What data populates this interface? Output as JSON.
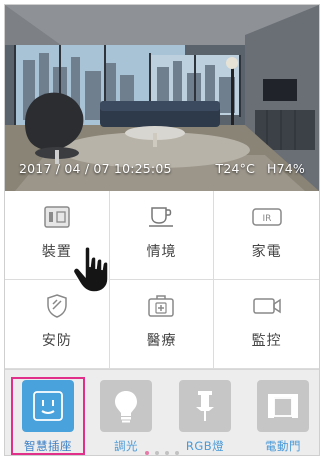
{
  "hero": {
    "datetime": "2017 / 04 / 07 10:25:05",
    "temperature": "T24°C",
    "humidity": "H74%"
  },
  "categories": [
    {
      "label": "裝置",
      "icon": "device-icon"
    },
    {
      "label": "情境",
      "icon": "coffee-cup-icon"
    },
    {
      "label": "家電",
      "icon": "ir-remote-icon"
    },
    {
      "label": "安防",
      "icon": "shield-icon"
    },
    {
      "label": "醫療",
      "icon": "medical-kit-icon"
    },
    {
      "label": "監控",
      "icon": "camera-icon"
    }
  ],
  "scenes": [
    {
      "label": "智慧插座",
      "icon": "socket-icon",
      "active": true
    },
    {
      "label": "調光",
      "icon": "bulb-icon",
      "active": false
    },
    {
      "label": "RGB燈",
      "icon": "pin-lamp-icon",
      "active": false
    },
    {
      "label": "電動門",
      "icon": "motor-door-icon",
      "active": false
    }
  ],
  "pagination": {
    "count": 4,
    "current": 0
  },
  "colors": {
    "active_tile": "#4aa2dc",
    "highlight_border": "#e0308a",
    "scene_label": "#4a9ad8"
  }
}
